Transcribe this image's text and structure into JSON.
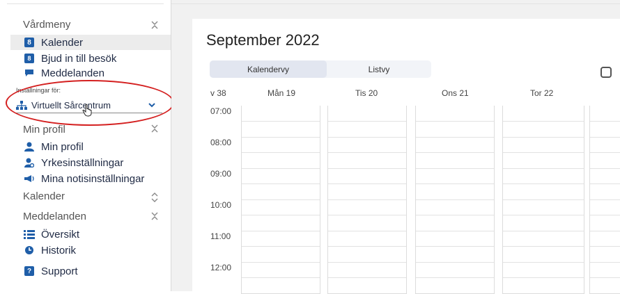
{
  "sidebar": {
    "vardmeny": {
      "title": "Vårdmeny",
      "items": [
        {
          "label": "Kalender",
          "icon": "calendar-icon",
          "active": true
        },
        {
          "label": "Bjud in till besök",
          "icon": "calendar-invite-icon"
        },
        {
          "label": "Meddelanden",
          "icon": "message-icon"
        }
      ]
    },
    "settings": {
      "label": "Inställningar för:",
      "value": "Virtuellt Sårcentrum",
      "icon": "org-chart-icon"
    },
    "min_profil": {
      "title": "Min profil",
      "items": [
        {
          "label": "Min profil",
          "icon": "user-icon"
        },
        {
          "label": "Yrkesinställningar",
          "icon": "user-settings-icon"
        },
        {
          "label": "Mina notisinställningar",
          "icon": "megaphone-icon"
        }
      ]
    },
    "kalender": {
      "title": "Kalender"
    },
    "meddelanden": {
      "title": "Meddelanden",
      "items": [
        {
          "label": "Översikt",
          "icon": "list-icon"
        },
        {
          "label": "Historik",
          "icon": "history-icon"
        }
      ]
    },
    "support": {
      "label": "Support",
      "icon": "help-icon"
    }
  },
  "calendar": {
    "title": "September 2022",
    "tabs": [
      {
        "label": "Kalendervy",
        "selected": true
      },
      {
        "label": "Listvy",
        "selected": false
      }
    ],
    "week": "v 38",
    "days": [
      "Mån 19",
      "Tis 20",
      "Ons 21",
      "Tor 22"
    ],
    "times": [
      "07:00",
      "08:00",
      "09:00",
      "10:00",
      "11:00",
      "12:00"
    ]
  },
  "colors": {
    "accent": "#1f5ea8",
    "highlight_oval": "#d42020",
    "sidebar_active": "#ececec",
    "main_bg": "#f1f1f1"
  }
}
